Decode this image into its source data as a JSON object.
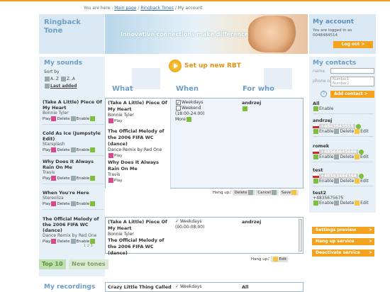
{
  "breadcrumb": {
    "prefix": "You are here :",
    "home": "Main page",
    "sep1": "/",
    "section": "Ringback Tones",
    "sep2": "/",
    "current": "My account"
  },
  "brand": {
    "line1": "Ringback",
    "line2": "Tone"
  },
  "banner": {
    "text": "Innovative connections make difference"
  },
  "account": {
    "title": "My account",
    "logged": "You are logged in as",
    "number": "0048484514",
    "logout": "Log out"
  },
  "sounds": {
    "title": "My sounds",
    "sortby": "Sort by",
    "sort_az": "A..Z",
    "sort_za": "Z..A",
    "last_added": "Last added",
    "items": [
      {
        "title": "(Take A Little) Piece Of My Heart",
        "artist": "Bonnie Tyler",
        "play": "Play",
        "delete": "Delete",
        "enable": "Enable"
      },
      {
        "title": "Cold As Ice (Jumpstyle Edit)",
        "artist": "Starsplash",
        "play": "Play",
        "delete": "Delete",
        "enable": "Enable"
      },
      {
        "title": "Why Does It Always Rain On Me",
        "artist": "Travis",
        "play": "Play",
        "delete": "Delete",
        "enable": "Enable"
      },
      {
        "title": "When You're Here",
        "artist": "Stereoliza",
        "play": "Play",
        "delete": "Delete",
        "enable": "Enable"
      },
      {
        "title": "The Official Melody of the 2006 FIFA WC (dance)",
        "artist": "Dance Remix by Red One",
        "play": "Play",
        "delete": "Delete",
        "enable": "Enable"
      }
    ],
    "pages": "1 2 3"
  },
  "tabs": {
    "top10": "Top 10",
    "newtones": "New tones"
  },
  "recordings": {
    "title": "My recordings"
  },
  "setup": {
    "label": "Set up new RBT"
  },
  "cols": {
    "what": "What",
    "when": "When",
    "forwho": "For who"
  },
  "panel1": {
    "what": [
      {
        "title": "(Take A Little) Piece Of My Heart",
        "artist": "Bonnie Tyler",
        "play": "Play"
      },
      {
        "title": "The Official Melody of the 2006 FIFA WC (dance)",
        "artist": "Dance Remix by Red One",
        "play": "Play"
      },
      {
        "title": "Why Does It Always Rain On Me",
        "artist": "Travis",
        "play": "Play"
      }
    ],
    "when": {
      "weekdays": "Weekdays",
      "weekend": "Weekend",
      "hours": "(18:00-24:00)",
      "more": "More"
    },
    "who": "andrzej",
    "hangup": "Hang up",
    "delete": "Delete",
    "cancel": "Cancel",
    "save": "Save"
  },
  "panel2": {
    "what1": "(Take A Little) Piece Of My Heart",
    "artist1": "Bonnie Tyler",
    "what2": "The Official Melody of the 2006 FIFA WC (dance)",
    "when1": "Weekdays",
    "hours1": "(00:00-08:00)",
    "who": "andrzej",
    "hangup": "Hang up",
    "edit": "Edit"
  },
  "panel3": {
    "what": "Crazy Little Thing Called",
    "when": "Weekdays",
    "who": "All"
  },
  "contacts": {
    "title": "My contacts",
    "name_label": "name",
    "phone_label": "phone nr",
    "num1": "Number1",
    "num2": "Number2",
    "add": "Add contact",
    "all": "All",
    "all_enable": "Enable",
    "list": [
      {
        "name": "andrzej",
        "phone": "+4843543555"
      },
      {
        "name": "romek",
        "phone": "+48564645666"
      },
      {
        "name": "test",
        "phone": "+48563464364"
      }
    ],
    "enable": "Enable",
    "delete": "Delete",
    "edit": "Edit",
    "test2": {
      "name": "test2",
      "phone": "+4835675675",
      "enable": "Enable",
      "delete": "Delete",
      "edit": "Edit"
    }
  },
  "services": {
    "settings": "Settings preview",
    "hangup": "Hang up service",
    "deactivate": "Deactivate service"
  }
}
